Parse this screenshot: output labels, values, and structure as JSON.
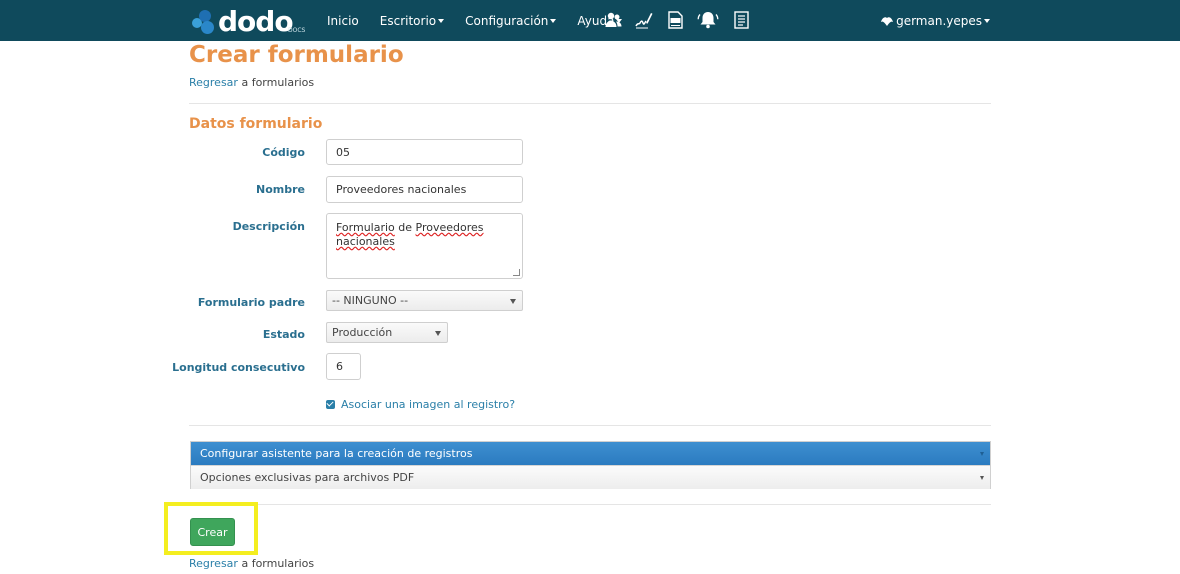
{
  "nav": {
    "logo_text": "dodo",
    "logo_sub": "DOCS",
    "items": [
      {
        "label": "Inicio",
        "has_caret": false
      },
      {
        "label": "Escritorio",
        "has_caret": true
      },
      {
        "label": "Configuración",
        "has_caret": true
      },
      {
        "label": "Ayuda",
        "has_caret": true
      }
    ],
    "icons": [
      "users-icon",
      "signature-icon",
      "pdf-icon",
      "bell-icon",
      "document-icon"
    ],
    "user": "german.yepes"
  },
  "page": {
    "title": "Crear formulario",
    "back_link_text": "Regresar",
    "back_suffix": "a formularios",
    "section_title": "Datos formulario"
  },
  "form": {
    "codigo_label": "Código",
    "codigo_value": "05",
    "nombre_label": "Nombre",
    "nombre_value": "Proveedores nacionales",
    "descripcion_label": "Descripción",
    "descripcion_word1": "Formulario",
    "descripcion_word2": "de",
    "descripcion_word3": "Proveedores",
    "descripcion_word4": "nacionales",
    "padre_label": "Formulario padre",
    "padre_value": "-- NINGUNO --",
    "estado_label": "Estado",
    "estado_value": "Producción",
    "longitud_label": "Longitud consecutivo",
    "longitud_value": "6",
    "imagen_label": "Asociar una imagen al registro?",
    "imagen_checked": true
  },
  "accordion": {
    "header": "Configurar asistente para la creación de registros",
    "sub": "Opciones exclusivas para archivos PDF"
  },
  "actions": {
    "crear": "Crear"
  },
  "colors": {
    "navbar": "#0f4a5c",
    "title_orange": "#e8924a",
    "label_blue": "#2a6f8f",
    "button_green": "#3fa65c",
    "highlight": "#f4ee1f"
  }
}
